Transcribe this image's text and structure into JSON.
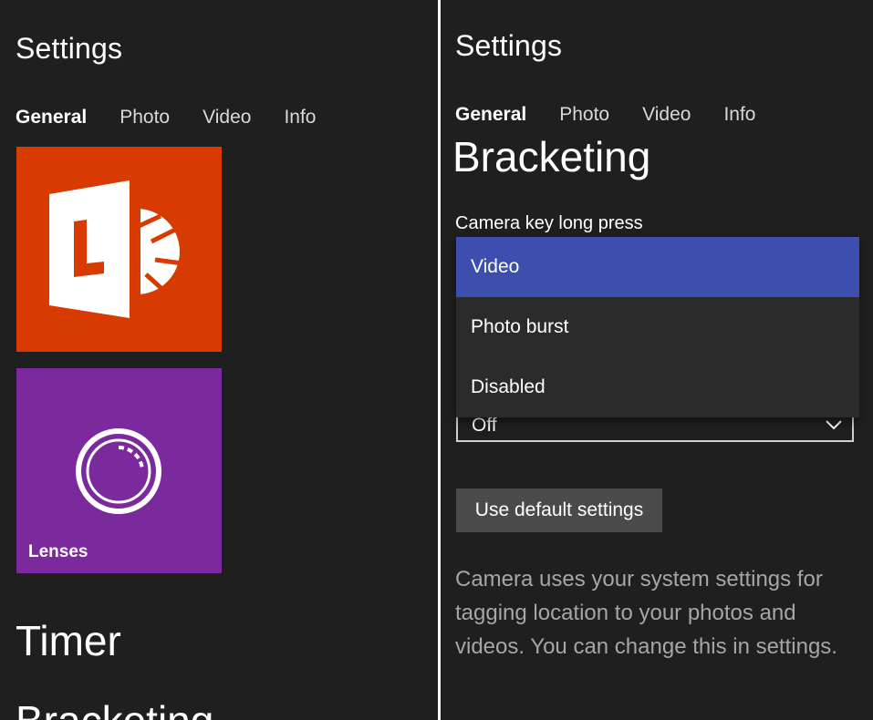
{
  "left": {
    "title": "Settings",
    "tabs": [
      {
        "label": "General",
        "active": true
      },
      {
        "label": "Photo",
        "active": false
      },
      {
        "label": "Video",
        "active": false
      },
      {
        "label": "Info",
        "active": false
      }
    ],
    "tiles": {
      "lens": {
        "icon": "office-lens-icon",
        "color": "#d83b01"
      },
      "lenses": {
        "label": "Lenses",
        "icon": "lens-shutter-icon",
        "color": "#7b2a9e"
      }
    },
    "headings": {
      "timer": "Timer",
      "bracketing": "Bracketing"
    }
  },
  "right": {
    "title": "Settings",
    "tabs": [
      {
        "label": "General",
        "active": true
      },
      {
        "label": "Photo",
        "active": false
      },
      {
        "label": "Video",
        "active": false
      },
      {
        "label": "Info",
        "active": false
      }
    ],
    "heading": "Bracketing",
    "camera_key": {
      "label": "Camera key long press",
      "options": [
        {
          "label": "Video",
          "selected": true
        },
        {
          "label": "Photo burst",
          "selected": false
        },
        {
          "label": "Disabled",
          "selected": false
        }
      ]
    },
    "combo_value": "Off",
    "default_button": "Use default settings",
    "location_note": "Camera uses your system settings for tagging location to your photos and videos. You can change this in settings.",
    "accent_color": "#3d4fae"
  }
}
